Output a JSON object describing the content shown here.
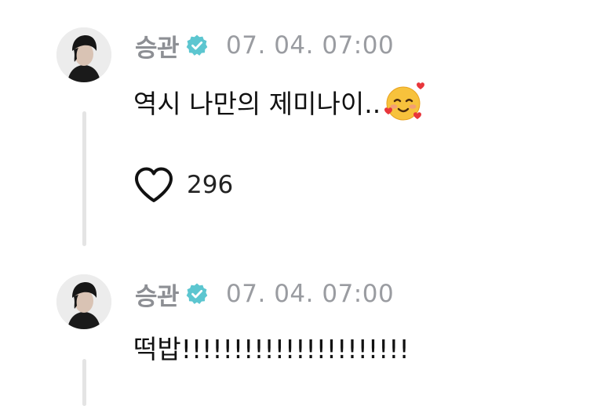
{
  "posts": [
    {
      "username": "승관",
      "timestamp": "07. 04. 07:00",
      "text": "역시 나만의 제미나이..",
      "emoji": "smiling-face-with-hearts-icon",
      "likes": "296"
    },
    {
      "username": "승관",
      "timestamp": "07. 04. 07:00",
      "text": "떡밥!!!!!!!!!!!!!!!!!!!!!!"
    }
  ],
  "colors": {
    "verified_badge": "#5cc6d0",
    "username": "#8d8f94",
    "timestamp": "#9a9ca1",
    "thread_line": "#e4e4e4"
  }
}
